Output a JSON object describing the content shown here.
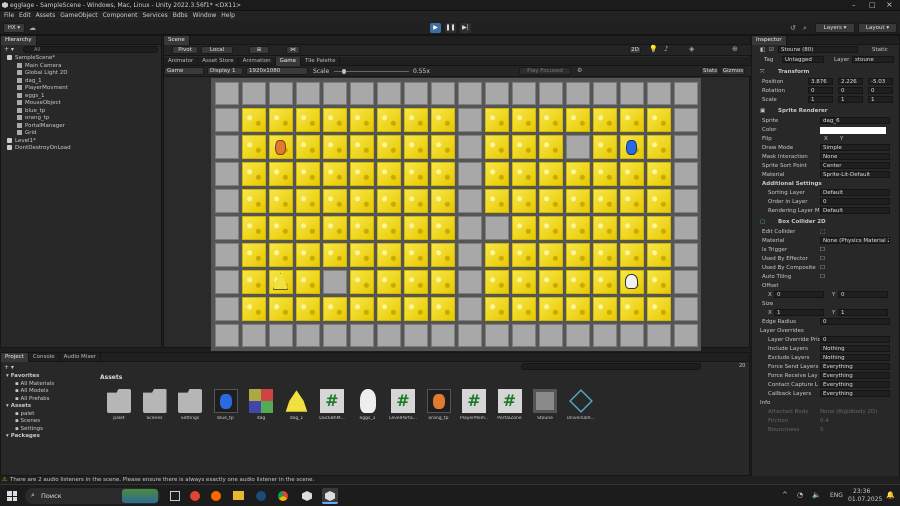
{
  "window": {
    "title": "egglage - SampleScene - Windows, Mac, Linux - Unity 2022.3.56f1* <DX11>"
  },
  "menu": [
    "File",
    "Edit",
    "Assets",
    "GameObject",
    "Component",
    "Services",
    "Bdbs",
    "Window",
    "Help"
  ],
  "toolbar": {
    "account": "HX",
    "layers": "Layers",
    "layout": "Layout"
  },
  "hierarchy": {
    "tab": "Hierarchy",
    "search": "All",
    "items": [
      {
        "label": "SampleScene*",
        "indent": 0
      },
      {
        "label": "Main Camera",
        "indent": 1
      },
      {
        "label": "Global Light 2D",
        "indent": 1
      },
      {
        "label": "dag_1",
        "indent": 1
      },
      {
        "label": "PlayerMovment",
        "indent": 1
      },
      {
        "label": "eggs_1",
        "indent": 1
      },
      {
        "label": "MouseObject",
        "indent": 1
      },
      {
        "label": "blue_tp",
        "indent": 1
      },
      {
        "label": "orang_tp",
        "indent": 1
      },
      {
        "label": "PortalManager",
        "indent": 1
      },
      {
        "label": "Grid",
        "indent": 1
      },
      {
        "label": "Level1*",
        "indent": 0
      },
      {
        "label": "DontDestroyOnLoad",
        "indent": 0
      }
    ]
  },
  "scene": {
    "tab": "Scene",
    "pivot": "Pivot",
    "local": "Local",
    "mode": "2D"
  },
  "game": {
    "tabs": [
      "Animator",
      "Asset Store",
      "Animation",
      "Game",
      "Tile Palette"
    ],
    "display_mode": "Game",
    "display": "Display 1",
    "resolution": "1920x1080",
    "scale_label": "Scale",
    "scale_value": "0.55x",
    "focus": "Play Focused",
    "stats": "Stats",
    "gizmos": "Gizmos"
  },
  "level": {
    "rows": [
      "gggggggggggggggggg",
      "gyyyyyyyygyyyyyyyg",
      "gyOyyyyyygyyygyBygg",
      "gyyyyyyyygyyyyyyyg",
      "gyyyyyyyygyyyyyyyg",
      "gyyyyyyyyggyyyyyyg",
      "gyyyyyyyygyyyyyyyg",
      "gyPygyyyygyyyyyEyg",
      "gyyyyyyyygyyyyyyyg",
      "gggggggggggggggggg"
    ]
  },
  "inspector": {
    "tab": "Inspector",
    "object_name": "Stoune (80)",
    "static": "Static",
    "tag_label": "Tag",
    "tag": "Untagged",
    "layer_label": "Layer",
    "layer": "stoune",
    "transform": {
      "title": "Transform",
      "position": "Position",
      "pos_x": "3.876",
      "pos_y": "2.226",
      "pos_z": "-5.03",
      "rotation": "Rotation",
      "rot_x": "0",
      "rot_y": "0",
      "rot_z": "0",
      "scale": "Scale",
      "sc_x": "1",
      "sc_y": "1",
      "sc_z": "1"
    },
    "sprite_renderer": {
      "title": "Sprite Renderer",
      "sprite_label": "Sprite",
      "sprite": "dag_6",
      "color_label": "Color",
      "flip_label": "Flip",
      "flip_x": "X",
      "flip_y": "Y",
      "draw_mode_label": "Draw Mode",
      "draw_mode": "Simple",
      "mask_label": "Mask Interaction",
      "mask": "None",
      "sort_point_label": "Sprite Sort Point",
      "sort_point": "Center",
      "material_label": "Material",
      "material": "Sprite-Lit-Default",
      "additional": "Additional Settings",
      "sorting_layer_label": "Sorting Layer",
      "sorting_layer": "Default",
      "order_label": "Order in Layer",
      "order": "0",
      "rendering_label": "Rendering Layer M",
      "rendering": "Default"
    },
    "box_collider": {
      "title": "Box Collider 2D",
      "edit": "Edit Collider",
      "material_label": "Material",
      "material": "None (Physics Material 2D)",
      "trigger": "Is Trigger",
      "effector": "Used By Effector",
      "composite": "Used By Composite",
      "auto_tiling": "Auto Tiling",
      "offset": "Offset",
      "off_x": "0",
      "off_y": "0",
      "size": "Size",
      "size_x": "1",
      "size_y": "1",
      "edge_radius_label": "Edge Radius",
      "edge_radius": "0",
      "layer_overrides": "Layer Overrides",
      "layer_override_prio": "Layer Override Prio",
      "lop_value": "0",
      "include": "Include Layers",
      "include_value": "Nothing",
      "exclude": "Exclude Layers",
      "exclude_value": "Nothing",
      "force_send": "Force Send Layers",
      "force_send_value": "Everything",
      "force_receive": "Force Receive Lay",
      "force_receive_value": "Everything",
      "contact_capture": "Contact Capture L",
      "contact_capture_value": "Everything",
      "callback": "Callback Layers",
      "callback_value": "Everything"
    },
    "info": {
      "title": "Info",
      "attached_body": "Attached Body",
      "attached_value": "None (Rigidbody 2D)",
      "friction": "Friction",
      "friction_value": "0.4",
      "bounciness": "Bounciness",
      "bounciness_value": "0"
    }
  },
  "project": {
    "tabs": [
      "Project",
      "Console",
      "Audio Mixer"
    ],
    "count": "20",
    "tree": [
      {
        "label": "Favorites",
        "indent": 0
      },
      {
        "label": "All Materials",
        "indent": 1
      },
      {
        "label": "All Models",
        "indent": 1
      },
      {
        "label": "All Prefabs",
        "indent": 1
      },
      {
        "label": "Assets",
        "indent": 0
      },
      {
        "label": "palet",
        "indent": 1
      },
      {
        "label": "Scenes",
        "indent": 1
      },
      {
        "label": "Settings",
        "indent": 1
      },
      {
        "label": "Packages",
        "indent": 0
      }
    ],
    "breadcrumb": "Assets",
    "assets": [
      {
        "label": "palet",
        "kind": "folder"
      },
      {
        "label": "Scenes",
        "kind": "folder"
      },
      {
        "label": "Settings",
        "kind": "folder"
      },
      {
        "label": "blue_tp",
        "kind": "blue"
      },
      {
        "label": "dag",
        "kind": "multi"
      },
      {
        "label": "dag_1",
        "kind": "egg"
      },
      {
        "label": "DuckBhM...",
        "kind": "script"
      },
      {
        "label": "eggs_1",
        "kind": "ghost"
      },
      {
        "label": "LevelPorta...",
        "kind": "script"
      },
      {
        "label": "orang_tp",
        "kind": "orange"
      },
      {
        "label": "PlayerMem...",
        "kind": "script"
      },
      {
        "label": "PortalZone",
        "kind": "script"
      },
      {
        "label": "Stoune",
        "kind": "stone"
      },
      {
        "label": "UniversalR...",
        "kind": "cube"
      }
    ]
  },
  "status": {
    "message": "There are 2 audio listeners in the scene. Please ensure there is always exactly one audio listener in the scene."
  },
  "taskbar": {
    "search": "Поиск",
    "lang": "ENG",
    "time": "23:36",
    "date": "01.07.2025"
  },
  "colors": {
    "accent": "#2c5d87",
    "yellow_tile": "#f5e02a",
    "stone_tile": "#9a9a9a"
  }
}
